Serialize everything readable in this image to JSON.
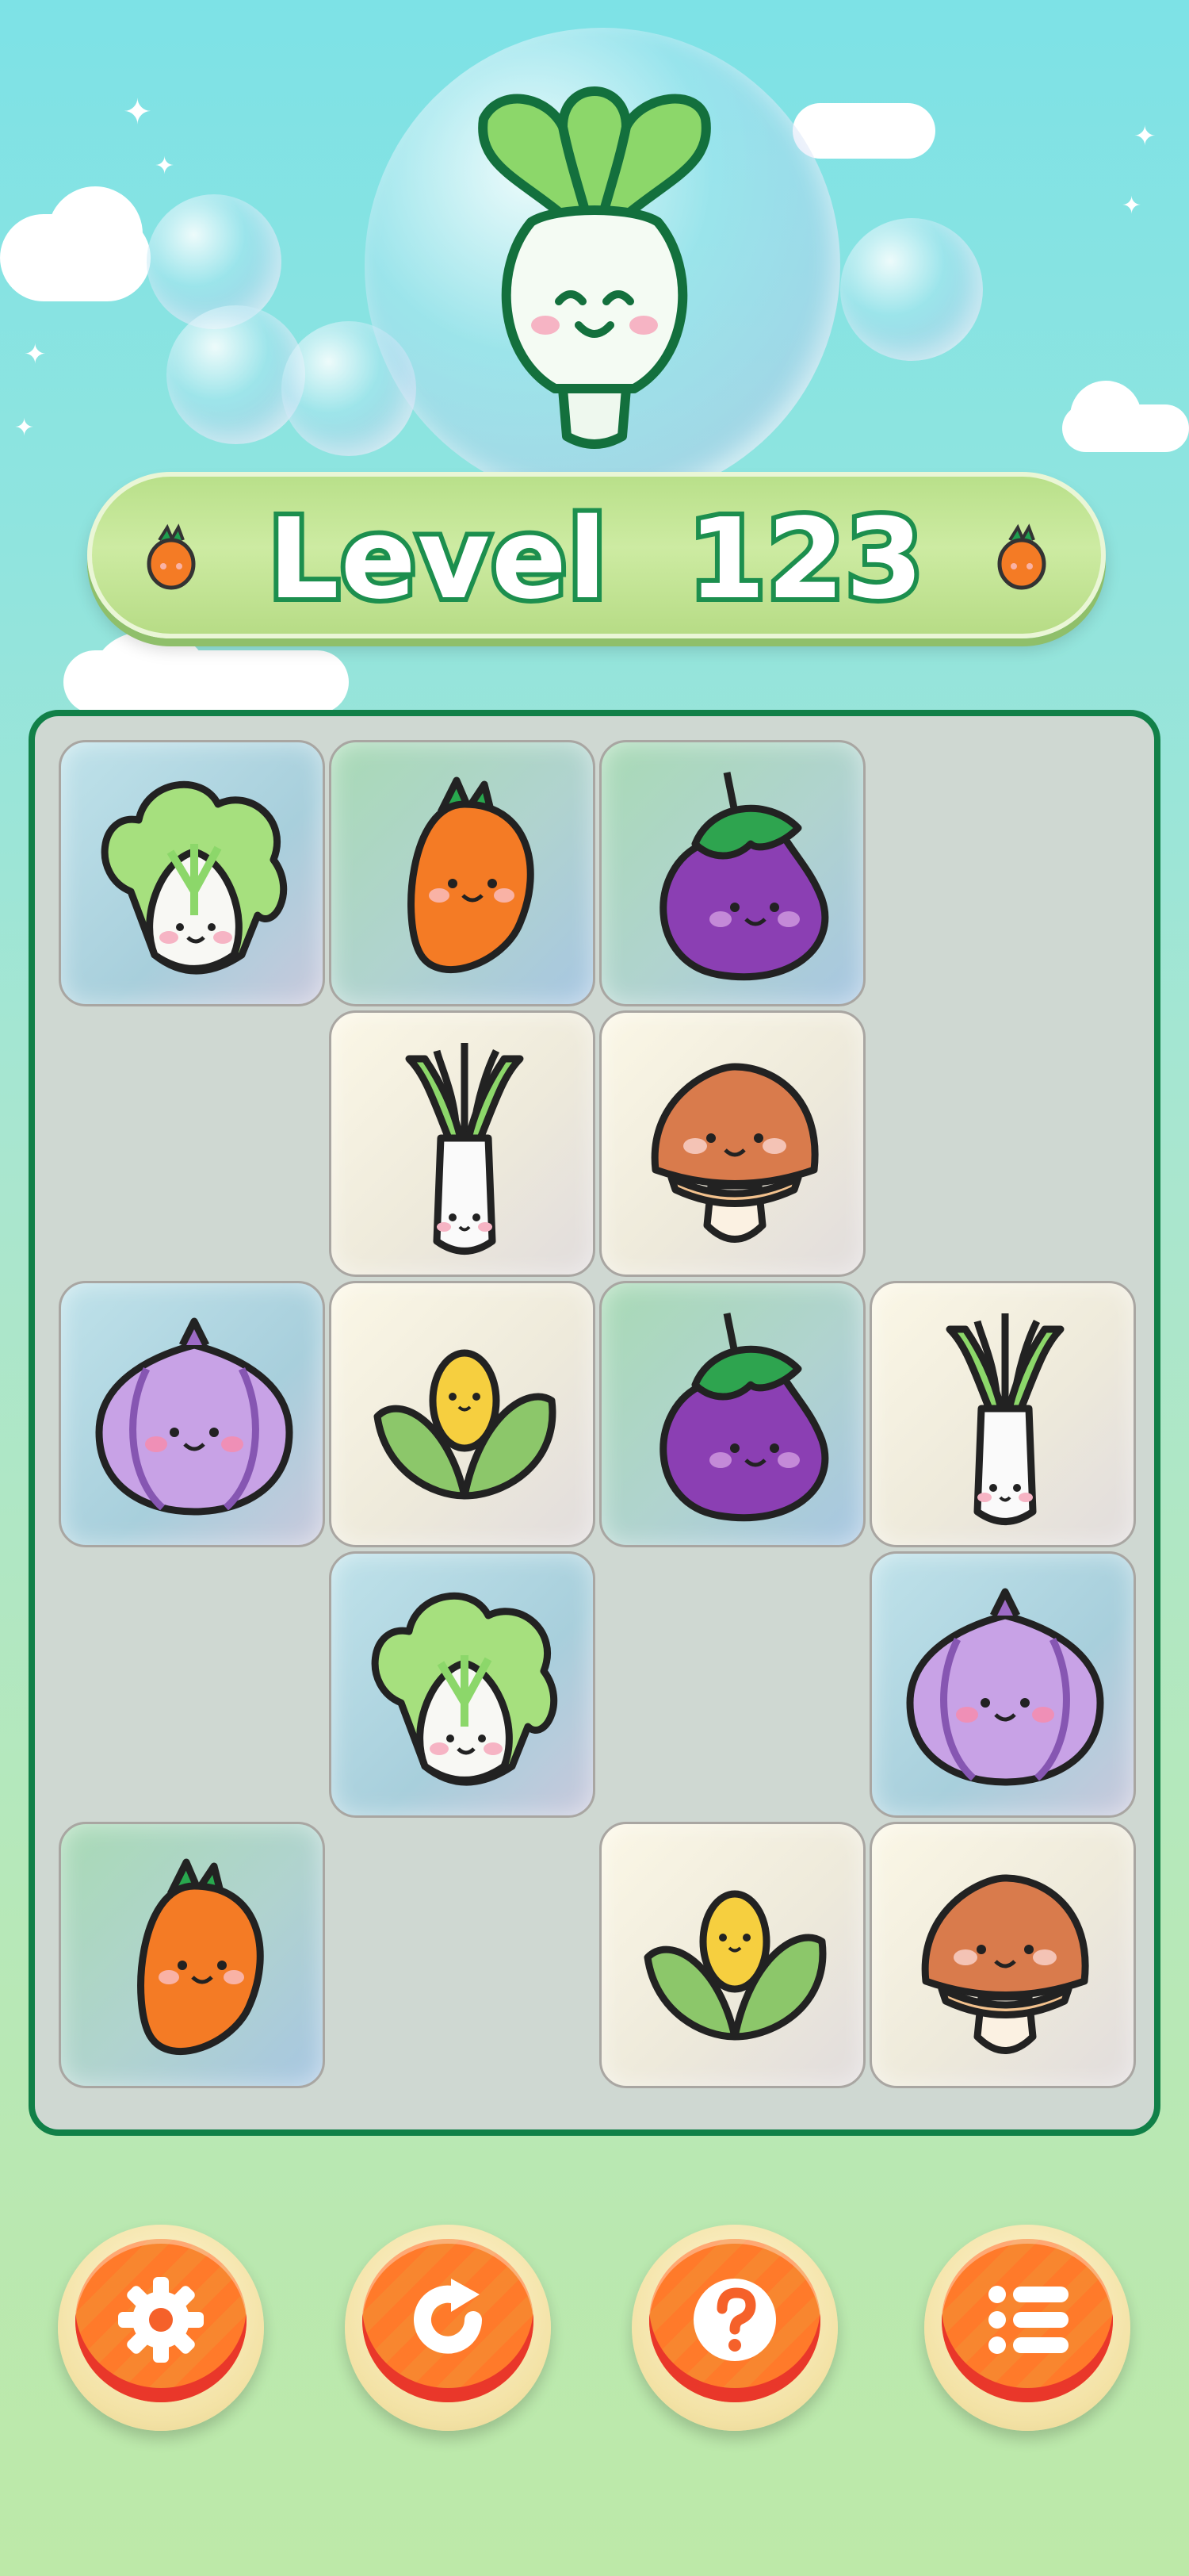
{
  "level": {
    "label": "Level",
    "number": "123"
  },
  "board": {
    "tiles": [
      {
        "vegetable": "napa-cabbage",
        "style": "blue"
      },
      {
        "vegetable": "carrot",
        "style": "green"
      },
      {
        "vegetable": "eggplant",
        "style": "green"
      },
      {
        "vegetable": "leek",
        "style": "cream"
      },
      {
        "vegetable": "mushroom",
        "style": "cream"
      },
      {
        "vegetable": "onion",
        "style": "blue"
      },
      {
        "vegetable": "corn",
        "style": "cream"
      },
      {
        "vegetable": "eggplant",
        "style": "green"
      },
      {
        "vegetable": "leek",
        "style": "cream"
      },
      {
        "vegetable": "napa-cabbage",
        "style": "blue"
      },
      {
        "vegetable": "onion",
        "style": "blue"
      },
      {
        "vegetable": "carrot",
        "style": "green"
      },
      {
        "vegetable": "corn",
        "style": "cream"
      },
      {
        "vegetable": "mushroom",
        "style": "cream"
      }
    ]
  },
  "buttons": [
    {
      "name": "settings-button",
      "icon": "gear-icon"
    },
    {
      "name": "restart-button",
      "icon": "refresh-icon"
    },
    {
      "name": "help-button",
      "icon": "question-icon"
    },
    {
      "name": "menu-button",
      "icon": "list-icon"
    }
  ],
  "colors": {
    "accent": "#118048",
    "button": "#ff7a2a",
    "banner": "#c3e69a"
  }
}
